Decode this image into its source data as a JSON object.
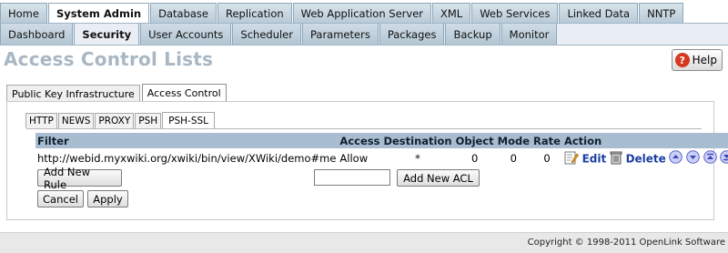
{
  "nav": {
    "primary": [
      "Home",
      "System Admin",
      "Database",
      "Replication",
      "Web Application Server",
      "XML",
      "Web Services",
      "Linked Data",
      "NNTP"
    ],
    "secondary": [
      "Dashboard",
      "Security",
      "User Accounts",
      "Scheduler",
      "Parameters",
      "Packages",
      "Backup",
      "Monitor"
    ]
  },
  "page": {
    "title": "Access Control Lists"
  },
  "help": {
    "label": "Help",
    "icon": "help-icon",
    "icon_glyph": "?"
  },
  "outer_tabs": [
    "Public Key Infrastructure",
    "Access Control"
  ],
  "inner_tabs": [
    "HTTP",
    "NEWS",
    "PROXY",
    "PSH",
    "PSH-SSL"
  ],
  "table": {
    "headers": [
      "Filter",
      "Access",
      "Destination",
      "Object",
      "Mode",
      "Rate",
      "Action"
    ],
    "rows": [
      {
        "filter": "http://webid.myxwiki.org/xwiki/bin/view/XWiki/demo#me",
        "access": "Allow",
        "destination": "*",
        "object": "0",
        "mode": "0",
        "rate": "0"
      }
    ],
    "actions": {
      "edit": "Edit",
      "delete": "Delete"
    }
  },
  "buttons": {
    "add_rule": "Add New Rule",
    "add_acl": "Add New ACL",
    "cancel": "Cancel",
    "apply": "Apply"
  },
  "acl_input": {
    "value": ""
  },
  "footer": {
    "copyright": "Copyright © 1998-2011 OpenLink Software"
  },
  "colors": {
    "header_bg": "#a8bdd0",
    "title": "#a9b7c3",
    "link": "#1b3fa0",
    "help_icon": "#d6371f"
  }
}
